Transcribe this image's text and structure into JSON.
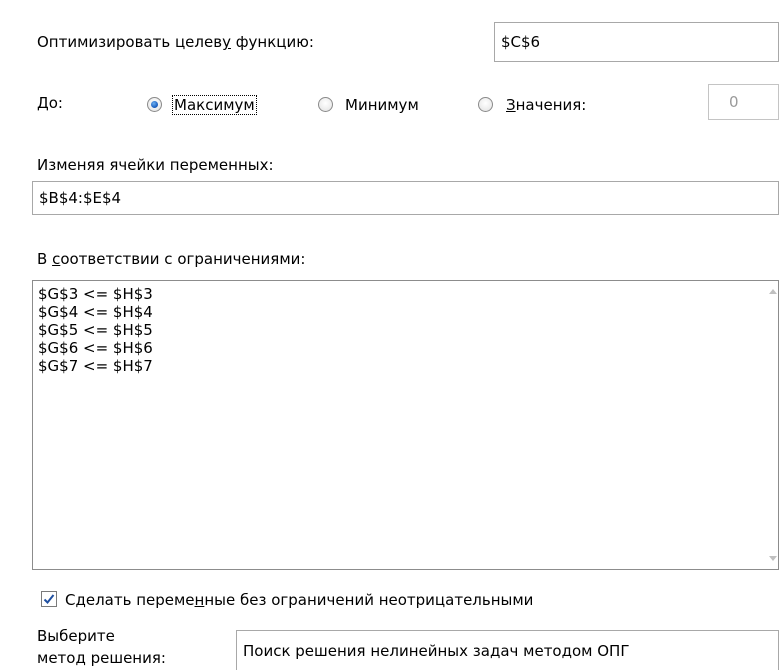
{
  "objective": {
    "label_before": "Оптимизировать целев",
    "label_accel": "у",
    "label_after": " функцию:",
    "value": "$C$6"
  },
  "to": {
    "label": "До:",
    "options": [
      {
        "label": "Максимум",
        "selected": true
      },
      {
        "label": "Минимум",
        "selected": false
      },
      {
        "label_accel": "З",
        "label_rest": "начения:",
        "selected": false
      }
    ],
    "value_of": "0"
  },
  "variables": {
    "label": "Изменяя ячейки переменных:",
    "value": "$B$4:$E$4"
  },
  "constraints": {
    "label_before": "В ",
    "label_accel": "с",
    "label_after": "оответствии с ограничениями:",
    "items": [
      "$G$3 <= $H$3",
      "$G$4 <= $H$4",
      "$G$5 <= $H$5",
      "$G$6 <= $H$6",
      "$G$7 <= $H$7"
    ]
  },
  "nonnegative": {
    "label_before": "Сделать переме",
    "label_accel": "н",
    "label_after": "ные без ограничений неотрицательными",
    "checked": true
  },
  "method": {
    "label_line1": "Выберите",
    "label_line2": "метод решения:",
    "value": "Поиск решения нелинейных задач методом ОПГ"
  },
  "colors": {
    "border": "#a8a8a8",
    "radio_dot": "#1f64c4",
    "check": "#1f4fa0"
  }
}
